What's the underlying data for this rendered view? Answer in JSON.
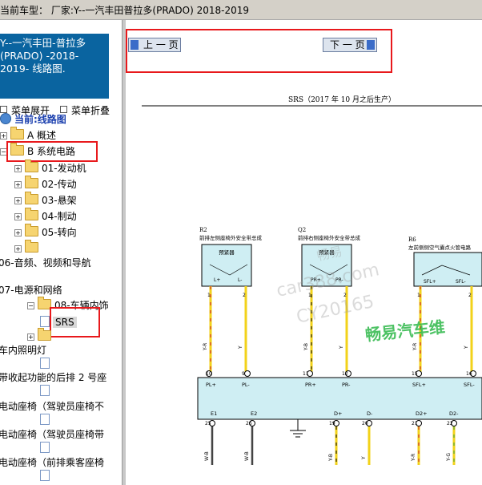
{
  "window": {
    "title": "当前车型： 厂家:Y--一汽丰田普拉多(PRADO) 2018-2019"
  },
  "sidebar": {
    "header_lines": [
      "Y--一汽丰田-普拉多",
      "(PRADO) -2018-",
      "2019- 线路图."
    ],
    "menu_expand": "菜单展开",
    "menu_collapse": "菜单折叠",
    "tree": {
      "current": "当前:线路图",
      "a": "A 概述",
      "b": "B 系统电路",
      "b_children": [
        "01-发动机",
        "02-传动",
        "03-悬架",
        "04-制动",
        "05-转向"
      ],
      "item_06": "06-音频、视频和导航",
      "item_07": "07-电源和网络",
      "item_08": "08-车辆内饰",
      "srs": "SRS",
      "extra": [
        "车内照明灯",
        "带收起功能的后排 2 号座",
        "电动座椅（驾驶员座椅不",
        "电动座椅（驾驶员座椅带",
        "电动座椅（前排乘客座椅"
      ]
    }
  },
  "toolbar": {
    "prev_label": "上 一 页",
    "next_label": "下 一 页"
  },
  "diagram": {
    "title": "SRS（2017 年 10 月之后生产）",
    "connectors": [
      {
        "code": "R2",
        "desc": "前排左侧座椅外安全带总成",
        "box": "预紧器",
        "pins": [
          "L+",
          "L-"
        ],
        "pin_nums": [
          "1",
          "2"
        ],
        "wires": [
          "Y-R",
          "Y"
        ]
      },
      {
        "code": "Q2",
        "desc": "前排右侧座椅外安全带总成",
        "box": "预紧器",
        "pins": [
          "PR+",
          "PR-"
        ],
        "pin_nums": [
          "1",
          "2"
        ],
        "wires": [
          "Y-B",
          "Y"
        ]
      },
      {
        "code": "R6",
        "desc": "左前侧侧空气囊点火管电路",
        "box": "",
        "pins": [
          "SFL+",
          "SFL-"
        ],
        "pin_nums": [
          "1",
          "2"
        ],
        "wires": [
          "Y-R",
          "Y"
        ]
      }
    ],
    "ecu_top_pins": [
      "PL+",
      "PL-",
      "PR+",
      "PR-",
      "SFL+",
      "SFL-"
    ],
    "ecu_top_nums": [
      "10",
      "9",
      "11",
      "12",
      "15",
      "16"
    ],
    "ecu_bottom_pins": [
      "E1",
      "E2",
      "D+",
      "D-",
      "D2+",
      "D2-"
    ],
    "ecu_bottom_nums": [
      "25",
      "26",
      "19",
      "20",
      "21",
      "22"
    ],
    "bottom_wires": [
      "W-B",
      "W-B",
      "Y-B",
      "Y",
      "Y-R",
      "Y-G"
    ],
    "watermarks": [
      "畅易",
      "car388.com",
      "CY20165",
      "畅易汽车维"
    ]
  }
}
